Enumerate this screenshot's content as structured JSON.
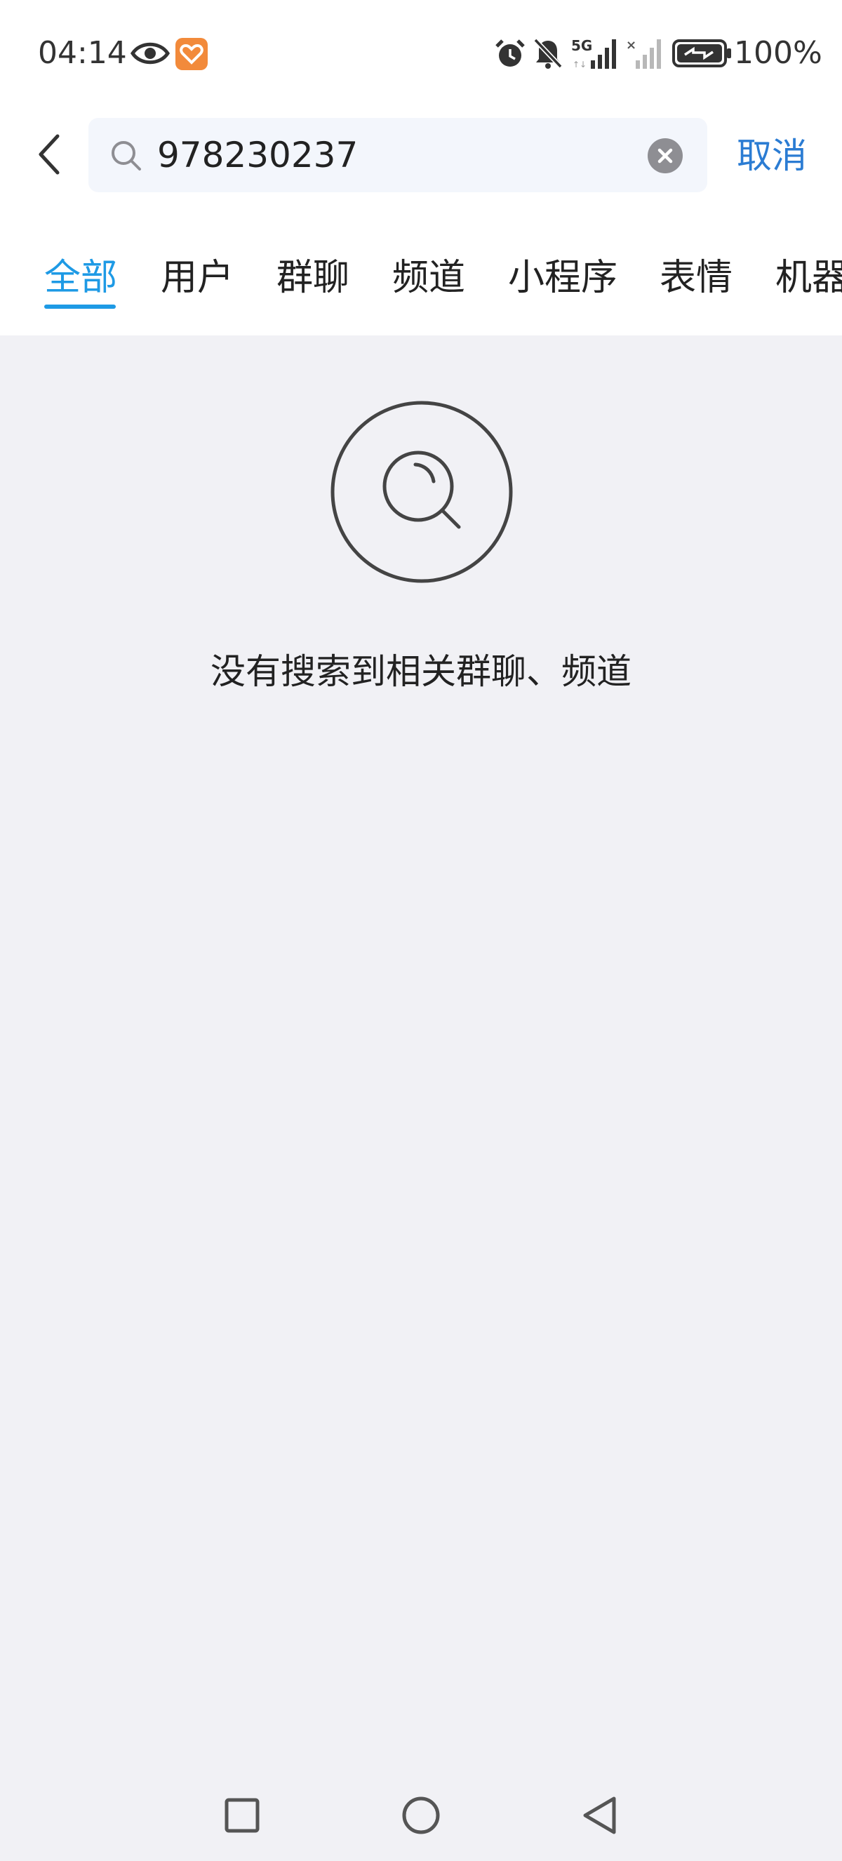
{
  "status_bar": {
    "time": "04:14",
    "battery_percent": "100%",
    "icons": [
      "eye-icon",
      "app-heart-icon",
      "alarm-icon",
      "bell-muted-icon",
      "signal-5g-icon",
      "signal-no-sim-icon",
      "battery-charging-icon"
    ]
  },
  "search": {
    "query": "978230237",
    "cancel_label": "取消"
  },
  "tabs": [
    {
      "label": "全部",
      "active": true
    },
    {
      "label": "用户",
      "active": false
    },
    {
      "label": "群聊",
      "active": false
    },
    {
      "label": "频道",
      "active": false
    },
    {
      "label": "小程序",
      "active": false
    },
    {
      "label": "表情",
      "active": false
    },
    {
      "label": "机器人",
      "active": false
    }
  ],
  "empty_state": {
    "message": "没有搜索到相关群聊、频道"
  },
  "colors": {
    "accent": "#1E9AE5",
    "cancel": "#2B7CD3",
    "background": "#F1F1F5",
    "search_box": "#F3F6FC"
  },
  "nav_bar": {
    "buttons": [
      "recents-square-icon",
      "home-circle-icon",
      "back-triangle-icon"
    ]
  }
}
